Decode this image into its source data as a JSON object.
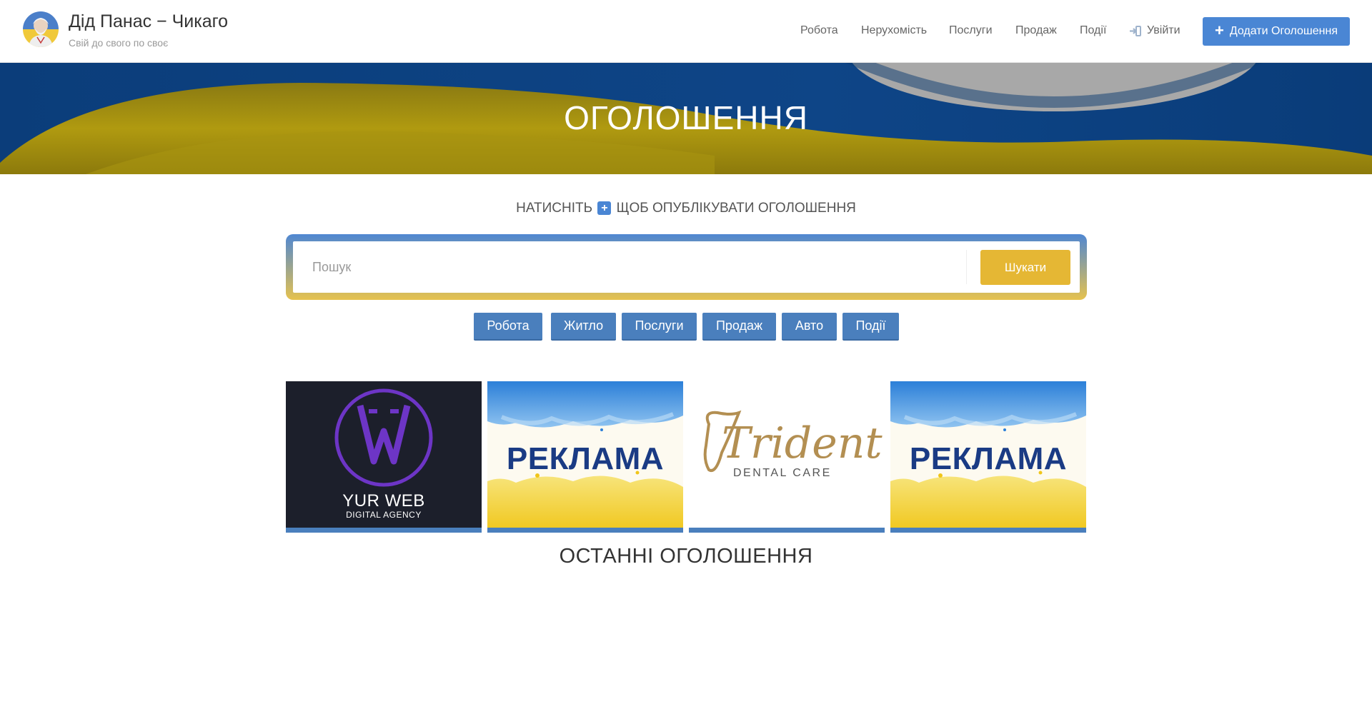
{
  "header": {
    "site_title": "Дід Панас − Чикаго",
    "site_subtitle": "Свій до свого по своє",
    "nav": [
      {
        "label": "Робота"
      },
      {
        "label": "Нерухомість"
      },
      {
        "label": "Послуги"
      },
      {
        "label": "Продаж"
      },
      {
        "label": "Події"
      }
    ],
    "login_label": "Увійти",
    "add_listing_label": "Додати Оголошення",
    "icons": {
      "login": "sign-in-icon",
      "add": "plus-icon",
      "logo": "avatar-logo"
    }
  },
  "hero": {
    "title": "ОГОЛОШЕННЯ"
  },
  "prompt": {
    "before": "НАТИСНІТЬ",
    "after": "ЩОБ ОПУБЛІКУВАТИ ОГОЛОШЕННЯ"
  },
  "search": {
    "placeholder": "Пошук",
    "value": "",
    "button_label": "Шукати"
  },
  "categories": [
    {
      "label": "Робота"
    },
    {
      "label": "Житло"
    },
    {
      "label": "Послуги"
    },
    {
      "label": "Продаж"
    },
    {
      "label": "Авто"
    },
    {
      "label": "Події"
    }
  ],
  "banners": [
    {
      "name": "YUR WEB",
      "subtitle": "DIGITAL AGENCY"
    },
    {
      "text": "РЕКЛАМА"
    },
    {
      "script": "Trident",
      "subtitle": "DENTAL CARE"
    },
    {
      "text": "РЕКЛАМА"
    }
  ],
  "latest": {
    "title": "ОСТАННІ ОГОЛОШЕННЯ"
  },
  "colors": {
    "accent_blue": "#4a86d4",
    "category_blue": "#4a7fbd",
    "search_yellow": "#e5b734",
    "flag_blue": "#0c3f7e",
    "flag_yellow": "#b5a000"
  }
}
